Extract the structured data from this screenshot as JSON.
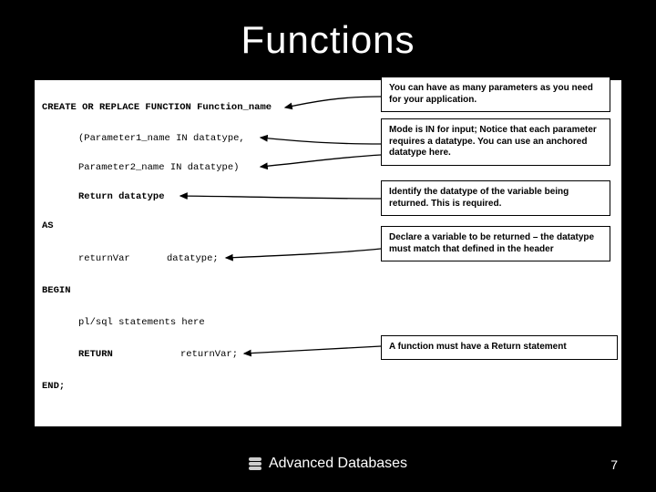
{
  "title": "Functions",
  "code": {
    "line1": "CREATE OR REPLACE FUNCTION Function_name",
    "line2": "(Parameter1_name IN datatype,",
    "line3": "Parameter2_name IN datatype)",
    "line4": "Return datatype",
    "line5": "AS",
    "line6a": "returnVar",
    "line6b": "datatype;",
    "line7": "BEGIN",
    "line8": "pl/sql statements here",
    "line9a": "RETURN",
    "line9b": "returnVar;",
    "line10": "END;"
  },
  "callouts": {
    "c1": "You can have as many parameters as you need for your application.",
    "c2": "Mode is IN for input; Notice that each parameter requires a datatype. You can use an anchored datatype here.",
    "c3": "Identify the datatype of the variable being returned. This is required.",
    "c4": "Declare a variable to be returned – the datatype must match that defined in the header",
    "c5": "A function must have a Return statement"
  },
  "footer": "Advanced Databases",
  "page": "7"
}
